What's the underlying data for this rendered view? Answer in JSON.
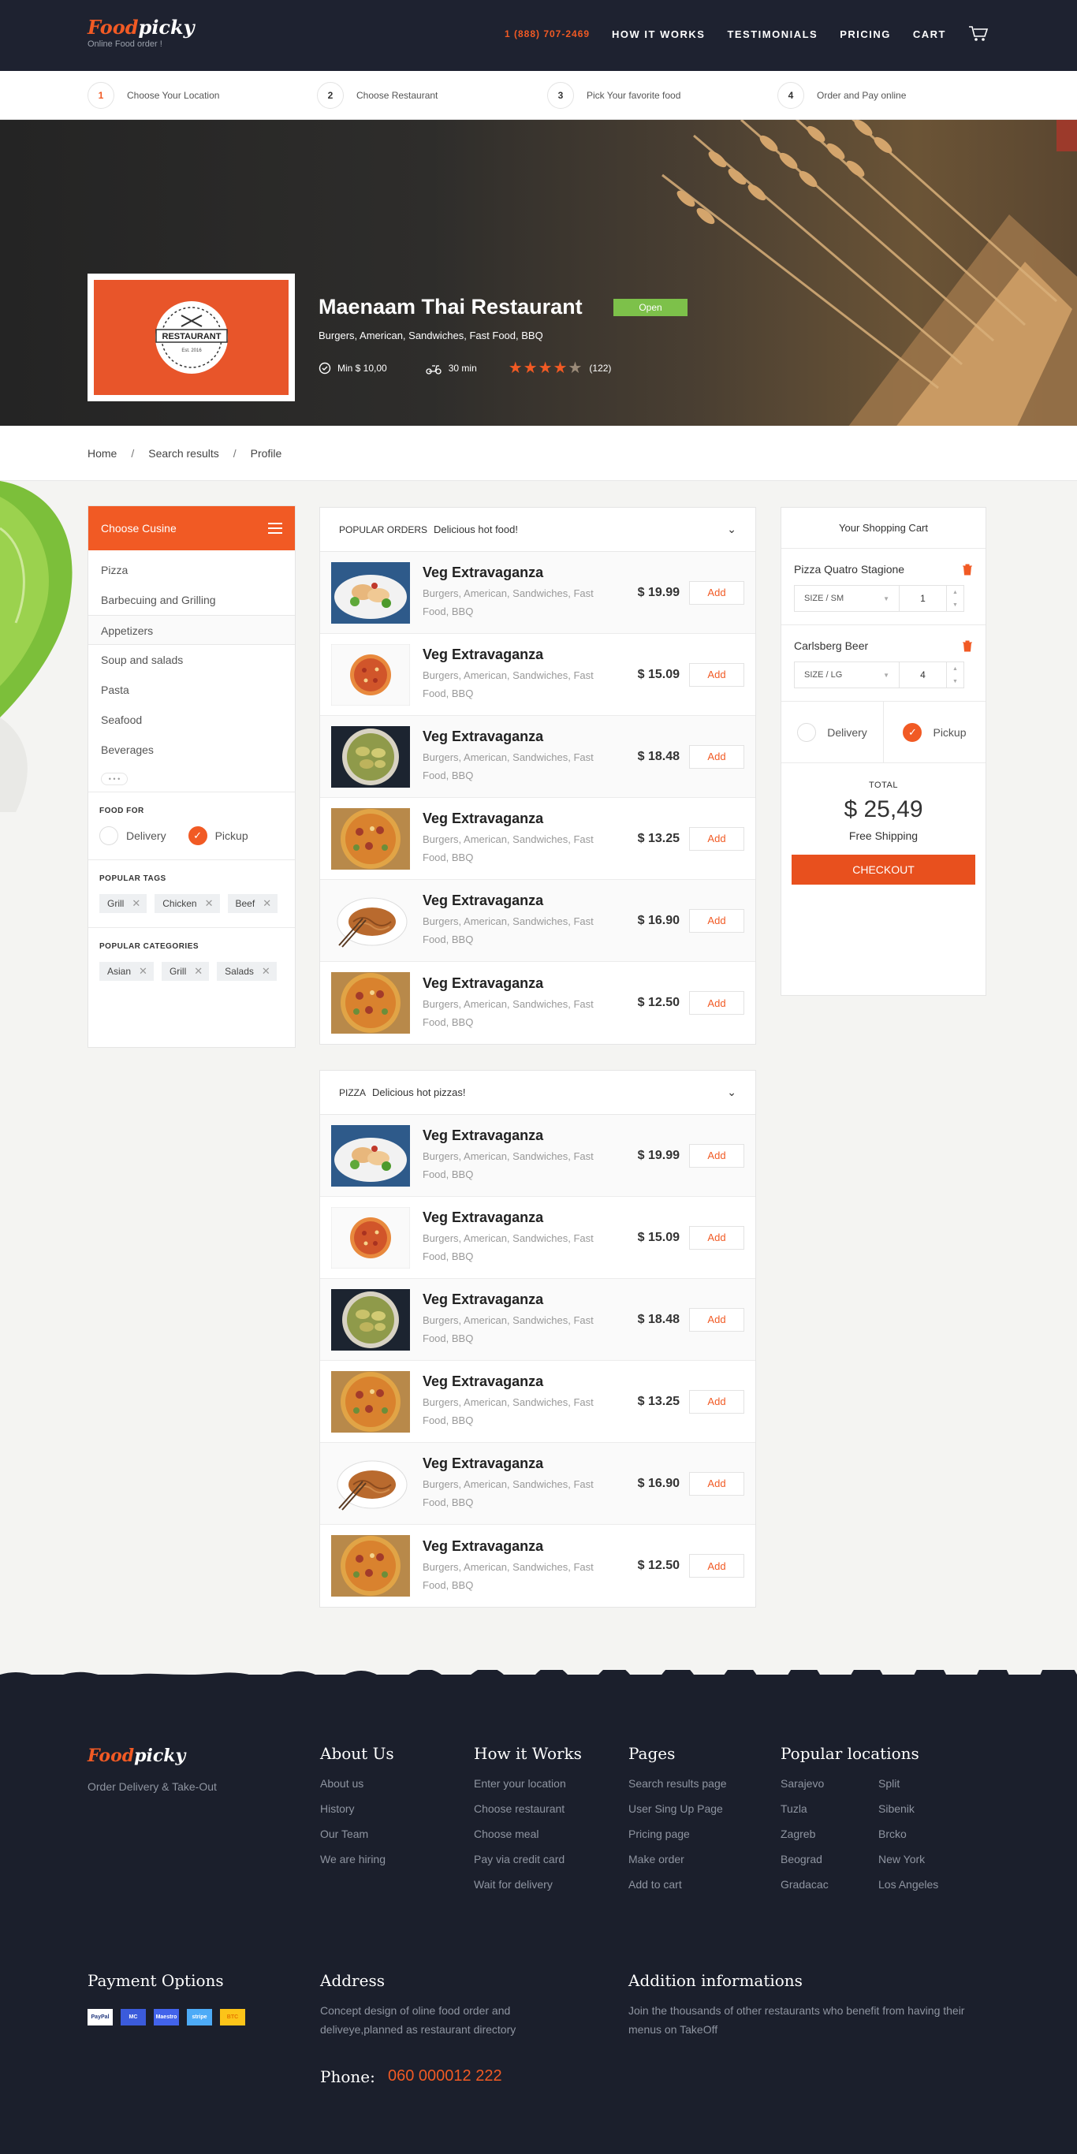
{
  "header": {
    "logo_a": "Food",
    "logo_b": "picky",
    "tagline": "Online Food order !",
    "phone": "1 (888) 707-2469",
    "nav": [
      "HOW IT WORKS",
      "TESTIMONIALS",
      "PRICING",
      "CART"
    ]
  },
  "steps": [
    {
      "num": "1",
      "label": "Choose Your Location"
    },
    {
      "num": "2",
      "label": "Choose Restaurant"
    },
    {
      "num": "3",
      "label": "Pick Your favorite food"
    },
    {
      "num": "4",
      "label": "Order and Pay online"
    }
  ],
  "restaurant": {
    "logo_text": "RESTAURANT",
    "logo_est": "Est. 2016",
    "name": "Maenaam Thai Restaurant",
    "status": "Open",
    "categories": "Burgers, American, Sandwiches, Fast Food, BBQ",
    "min_order": "Min $ 10,00",
    "delivery_time": "30 min",
    "rating": 4,
    "reviews": "(122)"
  },
  "breadcrumb": [
    "Home",
    "Search results",
    "Profile"
  ],
  "sidebar": {
    "title": "Choose Cusine",
    "cuisines": [
      "Pizza",
      "Barbecuing and Grilling",
      "Appetizers",
      "Soup and salads",
      "Pasta",
      "Seafood",
      "Beverages"
    ],
    "more": "• • •",
    "food_for_title": "FOOD FOR",
    "delivery": "Delivery",
    "pickup": "Pickup",
    "tags_title": "POPULAR TAGS",
    "tags": [
      "Grill",
      "Chicken",
      "Beef"
    ],
    "categories_title": "POPULAR CATEGORIES",
    "categories": [
      "Asian",
      "Grill",
      "Salads"
    ]
  },
  "menus": [
    {
      "title": "POPULAR ORDERS",
      "subtitle": "Delicious hot food!",
      "items": [
        {
          "name": "Veg Extravaganza",
          "desc": "Burgers, American, Sandwiches, Fast Food, BBQ",
          "price": "$ 19.99",
          "add": "Add",
          "img": "salad"
        },
        {
          "name": "Veg Extravaganza",
          "desc": "Burgers, American, Sandwiches, Fast Food, BBQ",
          "price": "$ 15.09",
          "add": "Add",
          "img": "pizza-small"
        },
        {
          "name": "Veg Extravaganza",
          "desc": "Burgers, American, Sandwiches, Fast Food, BBQ",
          "price": "$ 18.48",
          "add": "Add",
          "img": "dumplings"
        },
        {
          "name": "Veg Extravaganza",
          "desc": "Burgers, American, Sandwiches, Fast Food, BBQ",
          "price": "$ 13.25",
          "add": "Add",
          "img": "pizza"
        },
        {
          "name": "Veg Extravaganza",
          "desc": "Burgers, American, Sandwiches, Fast Food, BBQ",
          "price": "$ 16.90",
          "add": "Add",
          "img": "noodles"
        },
        {
          "name": "Veg Extravaganza",
          "desc": "Burgers, American, Sandwiches, Fast Food, BBQ",
          "price": "$ 12.50",
          "add": "Add",
          "img": "pizza"
        }
      ]
    },
    {
      "title": "PIZZA",
      "subtitle": "Delicious hot pizzas!",
      "items": [
        {
          "name": "Veg Extravaganza",
          "desc": "Burgers, American, Sandwiches, Fast Food, BBQ",
          "price": "$ 19.99",
          "add": "Add",
          "img": "salad"
        },
        {
          "name": "Veg Extravaganza",
          "desc": "Burgers, American, Sandwiches, Fast Food, BBQ",
          "price": "$ 15.09",
          "add": "Add",
          "img": "pizza-small"
        },
        {
          "name": "Veg Extravaganza",
          "desc": "Burgers, American, Sandwiches, Fast Food, BBQ",
          "price": "$ 18.48",
          "add": "Add",
          "img": "dumplings"
        },
        {
          "name": "Veg Extravaganza",
          "desc": "Burgers, American, Sandwiches, Fast Food, BBQ",
          "price": "$ 13.25",
          "add": "Add",
          "img": "pizza"
        },
        {
          "name": "Veg Extravaganza",
          "desc": "Burgers, American, Sandwiches, Fast Food, BBQ",
          "price": "$ 16.90",
          "add": "Add",
          "img": "noodles"
        },
        {
          "name": "Veg Extravaganza",
          "desc": "Burgers, American, Sandwiches, Fast Food, BBQ",
          "price": "$ 12.50",
          "add": "Add",
          "img": "pizza"
        }
      ]
    }
  ],
  "cart": {
    "title": "Your Shopping Cart",
    "items": [
      {
        "name": "Pizza Quatro Stagione",
        "size_label": "SIZE /",
        "size": "SM",
        "qty": "1"
      },
      {
        "name": "Carlsberg Beer",
        "size_label": "SIZE /",
        "size": "LG",
        "qty": "4"
      }
    ],
    "delivery": "Delivery",
    "pickup": "Pickup",
    "total_label": "TOTAL",
    "total": "$ 25,49",
    "shipping": "Free Shipping",
    "checkout": "CHECKOUT"
  },
  "footer": {
    "logo_a": "Food",
    "logo_b": "picky",
    "tagline": "Order Delivery & Take-Out",
    "about_title": "About Us",
    "about": [
      "About us",
      "History",
      "Our Team",
      "We are hiring"
    ],
    "how_title": "How it Works",
    "how": [
      "Enter your location",
      "Choose restaurant",
      "Choose meal",
      "Pay via credit card",
      "Wait for delivery"
    ],
    "pages_title": "Pages",
    "pages": [
      "Search results page",
      "User Sing Up Page",
      "Pricing page",
      "Make order",
      "Add to cart"
    ],
    "locations_title": "Popular locations",
    "locations": [
      "Sarajevo",
      "Split",
      "Tuzla",
      "Sibenik",
      "Zagreb",
      "Brcko",
      "Beograd",
      "New York",
      "Gradacac",
      "Los Angeles"
    ],
    "payment_title": "Payment Options",
    "payments": [
      "PayPal",
      "MC",
      "Maestro",
      "stripe",
      "BTC"
    ],
    "address_title": "Address",
    "address": "Concept design of oline food order and deliveye,planned as restaurant directory",
    "phone_label": "Phone:",
    "phone": "060 000012 222",
    "info_title": "Addition informations",
    "info": "Join the thousands of other restaurants who benefit from having their menus on TakeOff"
  },
  "colors": {
    "accent": "#f15a24",
    "dark": "#1e2230",
    "open": "#7dc14a"
  }
}
